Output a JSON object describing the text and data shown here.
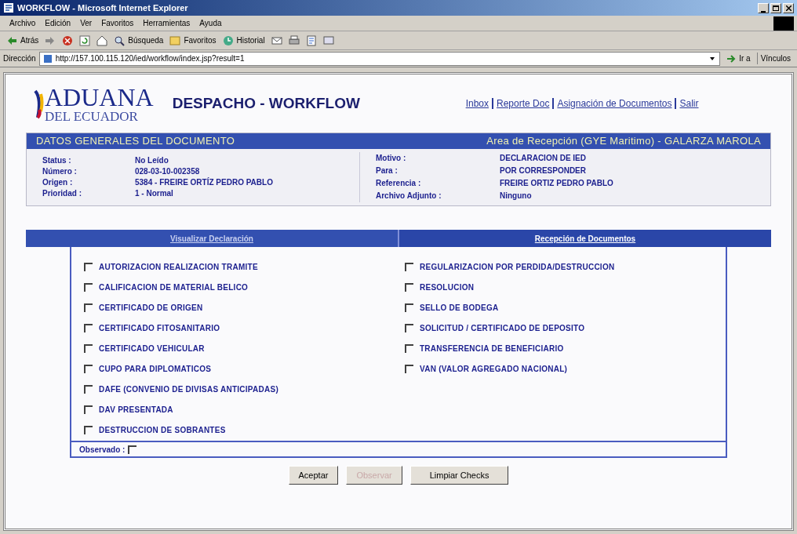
{
  "window": {
    "title": "WORKFLOW - Microsoft Internet Explorer"
  },
  "menu": [
    "Archivo",
    "Edición",
    "Ver",
    "Favoritos",
    "Herramientas",
    "Ayuda"
  ],
  "toolbar": [
    {
      "kind": "back",
      "label": "Atrás"
    },
    {
      "kind": "forward"
    },
    {
      "kind": "stop"
    },
    {
      "kind": "refresh"
    },
    {
      "kind": "home"
    },
    {
      "kind": "search",
      "label": "Búsqueda"
    },
    {
      "kind": "favorites",
      "label": "Favoritos"
    },
    {
      "kind": "history",
      "label": "Historial"
    },
    {
      "kind": "mail"
    },
    {
      "kind": "print"
    },
    {
      "kind": "edit"
    },
    {
      "kind": "discuss"
    }
  ],
  "address_bar": {
    "label": "Dirección",
    "value": "http://157.100.115.120/ied/workflow/index.jsp?result=1",
    "go": "Ir a",
    "links": "Vínculos"
  },
  "header": {
    "logo_top": "ADUANA",
    "logo_bottom": "DEL ECUADOR",
    "title": "DESPACHO - WORKFLOW",
    "nav": [
      "Inbox",
      "Reporte Doc",
      "Asignación de Documentos",
      "Salir"
    ]
  },
  "document_panel": {
    "title": "DATOS GENERALES DEL DOCUMENTO",
    "area": "Area de Recepción (GYE Maritimo) - GALARZA MAROLA",
    "left_fields": [
      {
        "label": "Status :",
        "value": "No Leído"
      },
      {
        "label": "Número :",
        "value": "028-03-10-002358"
      },
      {
        "label": "Origen :",
        "value": "5384 - FREIRE ORTÍZ PEDRO PABLO"
      },
      {
        "label": "Prioridad :",
        "value": "1 - Normal"
      }
    ],
    "right_fields": [
      {
        "label": "Motivo :",
        "value": "DECLARACION DE IED"
      },
      {
        "label": "Para :",
        "value": "POR CORRESPONDER"
      },
      {
        "label": "Referencia :",
        "value": "FREIRE ORTIZ PEDRO PABLO"
      },
      {
        "label": "Archivo Adjunto :",
        "value": "Ninguno"
      }
    ]
  },
  "tabs": [
    {
      "label": "Visualizar Declaración",
      "selected": false
    },
    {
      "label": "Recepción de Documentos",
      "selected": true
    }
  ],
  "documents_left": [
    {
      "label": "AUTORIZACION REALIZACION TRAMITE",
      "checked": false
    },
    {
      "label": "CALIFICACION DE MATERIAL BELICO",
      "checked": false
    },
    {
      "label": "CERTIFICADO DE ORIGEN",
      "checked": false
    },
    {
      "label": "CERTIFICADO FITOSANITARIO",
      "checked": false
    },
    {
      "label": "CERTIFICADO VEHICULAR",
      "checked": false
    },
    {
      "label": "CUPO PARA DIPLOMATICOS",
      "checked": false
    },
    {
      "label": "DAFE (CONVENIO DE DIVISAS ANTICIPADAS)",
      "checked": false
    },
    {
      "label": "DAV PRESENTADA",
      "checked": false
    },
    {
      "label": "DESTRUCCION DE SOBRANTES",
      "checked": false
    }
  ],
  "documents_right": [
    {
      "label": "REGULARIZACION POR PERDIDA/DESTRUCCION",
      "checked": false
    },
    {
      "label": "RESOLUCION",
      "checked": false
    },
    {
      "label": "SELLO DE BODEGA",
      "checked": false
    },
    {
      "label": "SOLICITUD / CERTIFICADO DE DEPOSITO",
      "checked": false
    },
    {
      "label": "TRANSFERENCIA DE BENEFICIARIO",
      "checked": false
    },
    {
      "label": "VAN (VALOR AGREGADO NACIONAL)",
      "checked": false
    }
  ],
  "observado": {
    "label": "Observado :",
    "checked": false
  },
  "buttons": [
    {
      "label": "Aceptar",
      "disabled": false
    },
    {
      "label": "Observar",
      "disabled": true
    },
    {
      "label": "Limpiar Checks",
      "disabled": false
    }
  ]
}
